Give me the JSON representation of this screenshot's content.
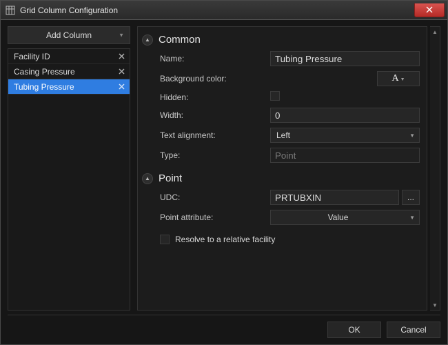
{
  "window": {
    "title": "Grid Column Configuration"
  },
  "sidebar": {
    "add_label": "Add Column",
    "columns": [
      {
        "label": "Facility ID",
        "selected": false
      },
      {
        "label": "Casing Pressure",
        "selected": false
      },
      {
        "label": "Tubing Pressure",
        "selected": true
      }
    ]
  },
  "sections": {
    "common": {
      "title": "Common",
      "fields": {
        "name_label": "Name:",
        "name_value": "Tubing Pressure",
        "bg_label": "Background color:",
        "hidden_label": "Hidden:",
        "hidden_checked": false,
        "width_label": "Width:",
        "width_value": "0",
        "align_label": "Text alignment:",
        "align_value": "Left",
        "type_label": "Type:",
        "type_value": "Point"
      }
    },
    "point": {
      "title": "Point",
      "fields": {
        "udc_label": "UDC:",
        "udc_value": "PRTUBXIN",
        "ellipsis": "...",
        "attr_label": "Point attribute:",
        "attr_value": "Value",
        "resolve_label": "Resolve to a relative facility",
        "resolve_checked": false
      }
    }
  },
  "footer": {
    "ok": "OK",
    "cancel": "Cancel"
  }
}
